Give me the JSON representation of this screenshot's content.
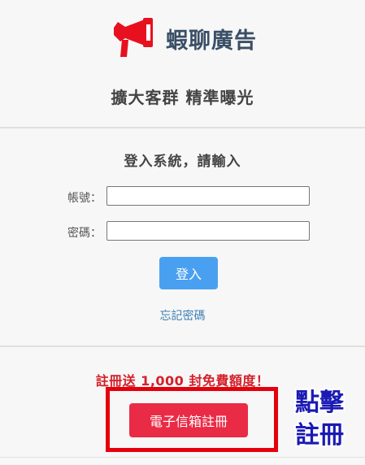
{
  "brand": {
    "name": "蝦聊廣告",
    "slogan": "擴大客群 精準曝光",
    "logo_icon": "megaphone-icon",
    "logo_color": "#e8101f"
  },
  "login": {
    "title": "登入系統，請輸入",
    "account_label": "帳號：",
    "account_value": "",
    "password_label": "密碼：",
    "password_value": "",
    "submit_label": "登入",
    "forgot_label": "忘記密碼"
  },
  "register": {
    "promo": "註冊送 1,000 封免費額度！",
    "button_label": "電子信箱註冊",
    "button_color": "#ea2b45"
  },
  "annotation": {
    "line1": "點擊",
    "line2": "註冊",
    "color": "#1a1ab3",
    "box_color": "#e5000d"
  }
}
